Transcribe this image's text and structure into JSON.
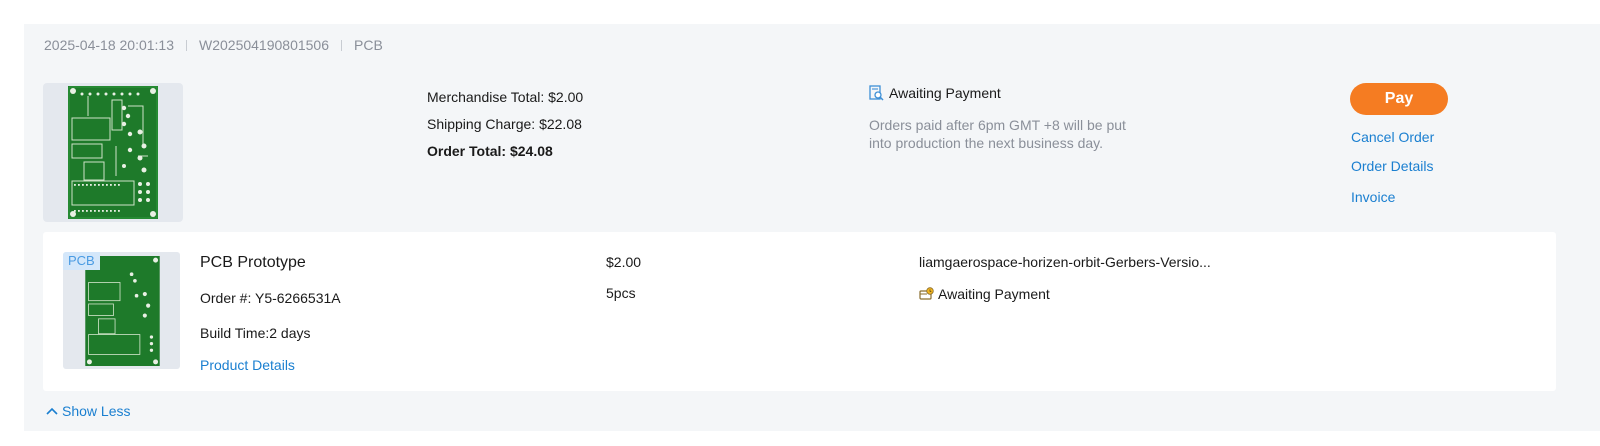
{
  "order": {
    "datetime": "2025-04-18 20:01:13",
    "order_number": "W202504190801506",
    "category": "PCB"
  },
  "totals": {
    "merchandise": "Merchandise Total: $2.00",
    "shipping": "Shipping Charge: $22.08",
    "order_total": "Order Total: $24.08"
  },
  "status": {
    "label": "Awaiting Payment",
    "icon": "search-document-icon",
    "note": "Orders paid after 6pm GMT +8 will be put into production the next business day."
  },
  "actions": {
    "pay": "Pay",
    "cancel": "Cancel Order",
    "details": "Order Details",
    "invoice": "Invoice"
  },
  "item": {
    "tag": "PCB",
    "title": "PCB Prototype",
    "order_no": "Order #: Y5-6266531A",
    "build_time": "Build Time:2 days",
    "details_link": "Product Details",
    "price": "$2.00",
    "quantity": "5pcs",
    "file": "liamgaerospace-horizen-orbit-Gerbers-Versio...",
    "status": "Awaiting Payment",
    "status_icon": "wallet-clock-icon"
  },
  "footer": {
    "show_less": "Show Less"
  },
  "colors": {
    "accent_orange": "#f57c22",
    "link_blue": "#1a7fd0",
    "card_bg": "#f4f6f8",
    "pcb_green": "#1e7a2a"
  }
}
